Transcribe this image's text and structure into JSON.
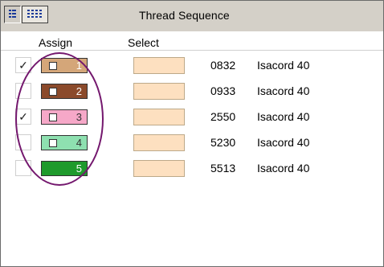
{
  "header": {
    "title": "Thread Sequence",
    "list_view_icon": "list-view-icon",
    "grid_view_icon": "grid-view-icon"
  },
  "columns": {
    "assign": "Assign",
    "select": "Select"
  },
  "check_glyph": "✓",
  "rows": [
    {
      "checked": true,
      "number": "1",
      "swatch_color": "#d4a679",
      "number_color": "#ffffff",
      "code": "0832",
      "name": "Isacord 40"
    },
    {
      "checked": false,
      "number": "2",
      "swatch_color": "#8b4a2b",
      "number_color": "#ffffff",
      "code": "0933",
      "name": "Isacord 40"
    },
    {
      "checked": true,
      "number": "3",
      "swatch_color": "#f6a8c8",
      "number_color": "#333333",
      "code": "2550",
      "name": "Isacord 40"
    },
    {
      "checked": false,
      "number": "4",
      "swatch_color": "#8ee0b0",
      "number_color": "#333333",
      "code": "5230",
      "name": "Isacord 40"
    },
    {
      "checked": false,
      "number": "5",
      "swatch_color": "#1f9a2c",
      "number_color": "#ffffff",
      "code": "5513",
      "name": "Isacord 40"
    }
  ],
  "colors": {
    "select_fill": "#fde0c0",
    "highlight_oval": "#74186e"
  }
}
